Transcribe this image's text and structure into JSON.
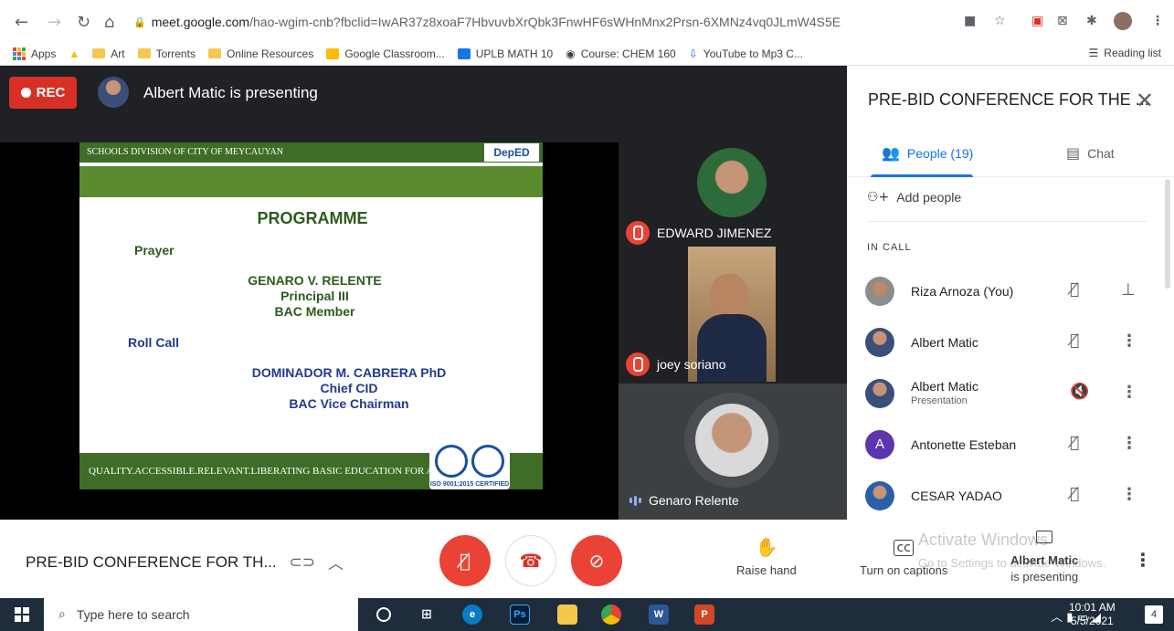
{
  "browser": {
    "url_host": "meet.google.com",
    "url_path": "/hao-wgim-cnb?fbclid=IwAR37z8xoaF7HbvuvbXrQbk3FnwHF6sWHnMnx2Prsn-6XMNz4vq0JLmW4S5E",
    "bookmarks": [
      "Apps",
      "Art",
      "Torrents",
      "Online Resources",
      "Google Classroom...",
      "UPLB MATH 10",
      "Course: CHEM 160",
      "YouTube to Mp3 C..."
    ],
    "reading_list": "Reading list"
  },
  "stage": {
    "rec_label": "REC",
    "presenter_text": "Albert Matic is presenting"
  },
  "slide": {
    "header": "SCHOOLS DIVISION OF CITY OF MEYCAUYAN",
    "logo": "DepED",
    "title": "PROGRAMME",
    "prayer": "Prayer",
    "name1": "GENARO V. RELENTE",
    "role1a": "Principal III",
    "role1b": "BAC Member",
    "rollcall": "Roll Call",
    "name2": "DOMINADOR M. CABRERA PhD",
    "role2a": "Chief CID",
    "role2b": "BAC Vice Chairman",
    "footer": "QUALITY.ACCESSIBLE.RELEVANT.LIBERATING BASIC EDUCATION FOR ALL",
    "iso": "ISO 9001:2015 CERTIFIED"
  },
  "tiles": [
    {
      "name": "EDWARD JIMENEZ"
    },
    {
      "name": "joey soriano"
    },
    {
      "name": "Genaro Relente"
    }
  ],
  "panel": {
    "title": "PRE-BID CONFERENCE FOR THE ...",
    "people_tab": "People (19)",
    "chat_tab": "Chat",
    "add_people": "Add people",
    "in_call": "IN CALL",
    "people": [
      {
        "name": "Riza Arnoza (You)",
        "sub": ""
      },
      {
        "name": "Albert Matic",
        "sub": ""
      },
      {
        "name": "Albert Matic",
        "sub": "Presentation"
      },
      {
        "name": "Antonette Esteban",
        "sub": "",
        "initial": "A"
      },
      {
        "name": "CESAR YADAO",
        "sub": ""
      }
    ]
  },
  "bottom": {
    "meeting_name": "PRE-BID CONFERENCE FOR TH...",
    "raise_hand": "Raise hand",
    "captions": "Turn on captions",
    "activate": "Activate Windows",
    "activate_sub": "Go to Settings to activate Windows.",
    "presenting_line1": "Albert Matic",
    "presenting_line2": "is presenting"
  },
  "taskbar": {
    "search_placeholder": "Type here to search",
    "time": "10:01 AM",
    "date": "5/5/2021",
    "notifications": "4"
  },
  "colors": {
    "rec_red": "#d93025",
    "accent_blue": "#1a73e8",
    "slide_green": "#3f6d28"
  }
}
